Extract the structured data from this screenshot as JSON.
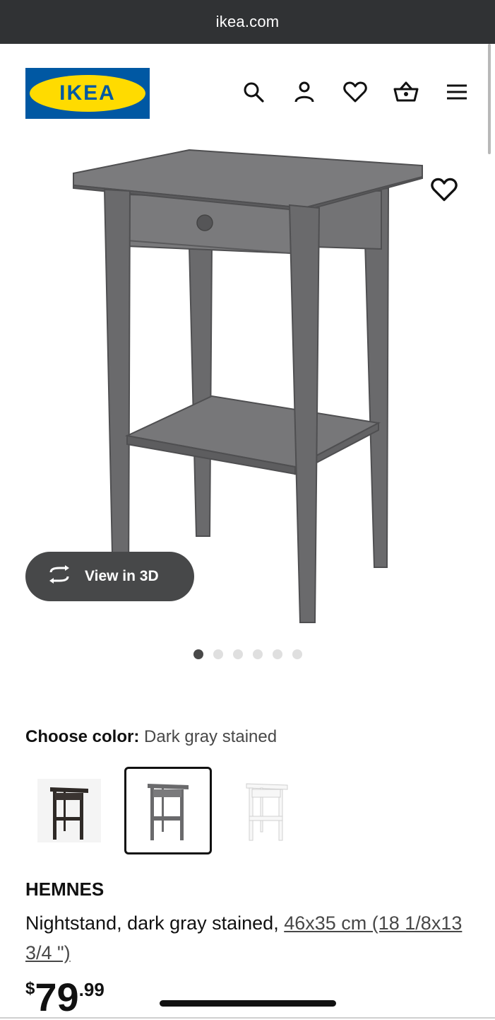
{
  "browser": {
    "url": "ikea.com"
  },
  "header": {
    "logo_text": "IKEA",
    "icons": [
      "search-icon",
      "user-icon",
      "heart-icon",
      "basket-icon",
      "menu-icon"
    ]
  },
  "gallery": {
    "view3d_label": "View in 3D",
    "image_count": 6,
    "active_index": 0
  },
  "color": {
    "label": "Choose color:",
    "value": "Dark gray stained",
    "options": [
      "black-brown",
      "dark-gray",
      "white"
    ],
    "selected_index": 1
  },
  "product": {
    "name": "HEMNES",
    "desc_prefix": "Nightstand, dark gray stained, ",
    "dimensions": "46x35 cm (18 1/8x13 3/4 \")"
  },
  "price": {
    "currency": "$",
    "integer": "79",
    "decimal": ".99"
  },
  "colors": {
    "brand_blue": "#0058a3",
    "brand_yellow": "#ffdb00",
    "urlbar": "#303234"
  }
}
